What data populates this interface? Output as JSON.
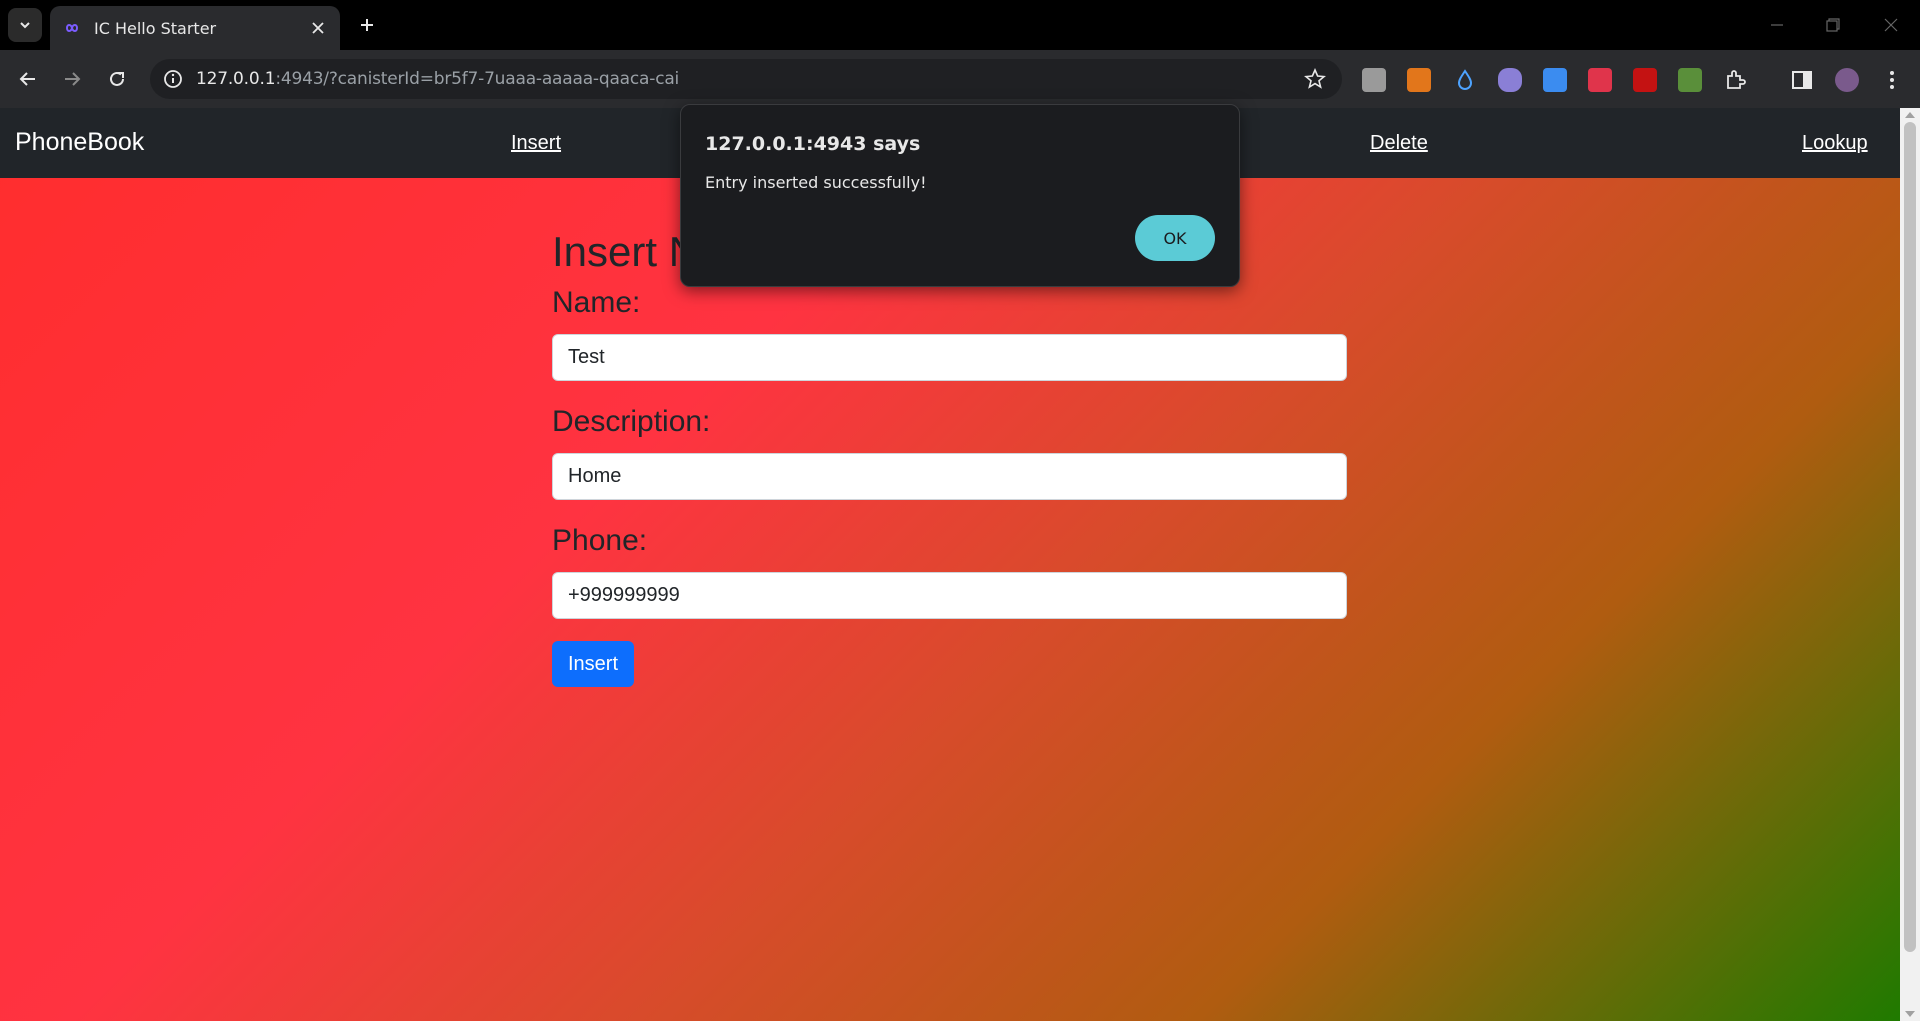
{
  "browser": {
    "tab_title": "IC Hello Starter",
    "url_host": "127.0.0.1",
    "url_rest": ":4943/?canisterId=br5f7-7uaaa-aaaaa-qaaca-cai"
  },
  "site": {
    "brand": "PhoneBook",
    "nav": {
      "insert": "Insert",
      "delete": "Delete",
      "lookup": "Lookup"
    }
  },
  "form": {
    "heading": "Insert N",
    "name_label": "Name:",
    "name_value": "Test",
    "description_label": "Description:",
    "description_value": "Home",
    "phone_label": "Phone:",
    "phone_value": "+999999999",
    "submit_label": "Insert"
  },
  "dialog": {
    "title": "127.0.0.1:4943 says",
    "message": "Entry inserted successfully!",
    "ok_label": "OK"
  },
  "colors": {
    "nav_bg": "#212529",
    "button_primary": "#0d6efd",
    "dialog_ok": "#5bcbd6"
  }
}
